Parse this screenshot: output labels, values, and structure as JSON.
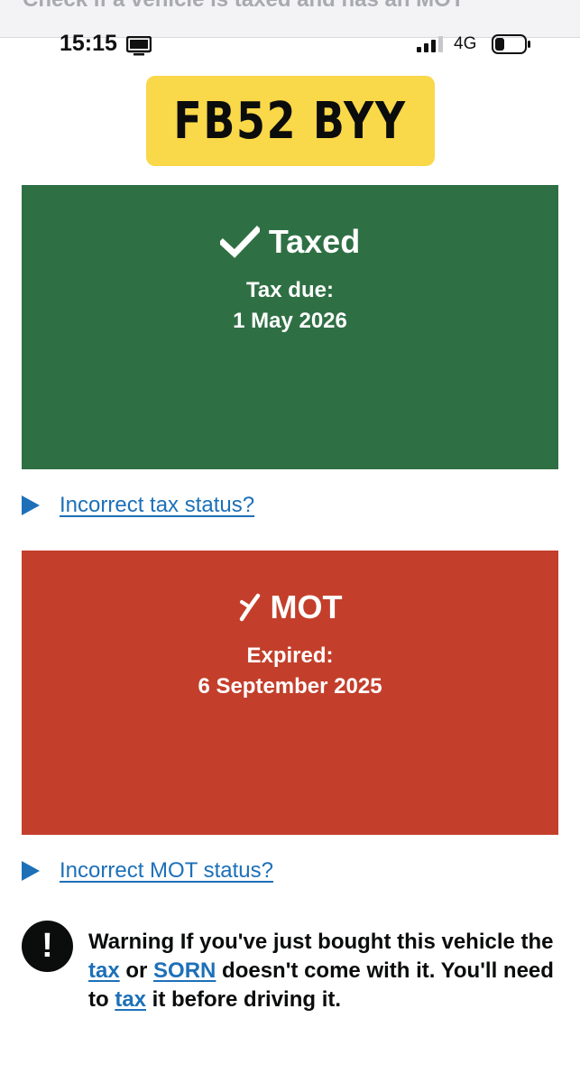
{
  "page": {
    "title": "Check if a vehicle is taxed and has an MOT"
  },
  "status_bar": {
    "time": "15:15",
    "network": "4G"
  },
  "vehicle": {
    "registration": "FB52 BYY"
  },
  "tax": {
    "status": "Taxed",
    "label": "Tax due:",
    "date": "1 May 2026",
    "color": "#2f6f44",
    "icon": "checkmark-icon",
    "report_link": "Incorrect tax status?"
  },
  "mot": {
    "status": "MOT",
    "label": "Expired:",
    "date": "6 September 2025",
    "color": "#c33f2b",
    "icon": "cross-icon",
    "report_link": "Incorrect MOT status?"
  },
  "warning": {
    "icon": "exclamation-icon",
    "icon_text": "!",
    "lead": "Warning If you've just bought this vehicle the ",
    "link_tax": "tax",
    "or": " or ",
    "link_sorn": "SORN",
    "middle": " doesn't come with it. You'll need to ",
    "link_tax_2": "tax",
    "end": " it before driving it."
  },
  "colors": {
    "link": "#1d70b8",
    "plate": "#f9d849"
  }
}
